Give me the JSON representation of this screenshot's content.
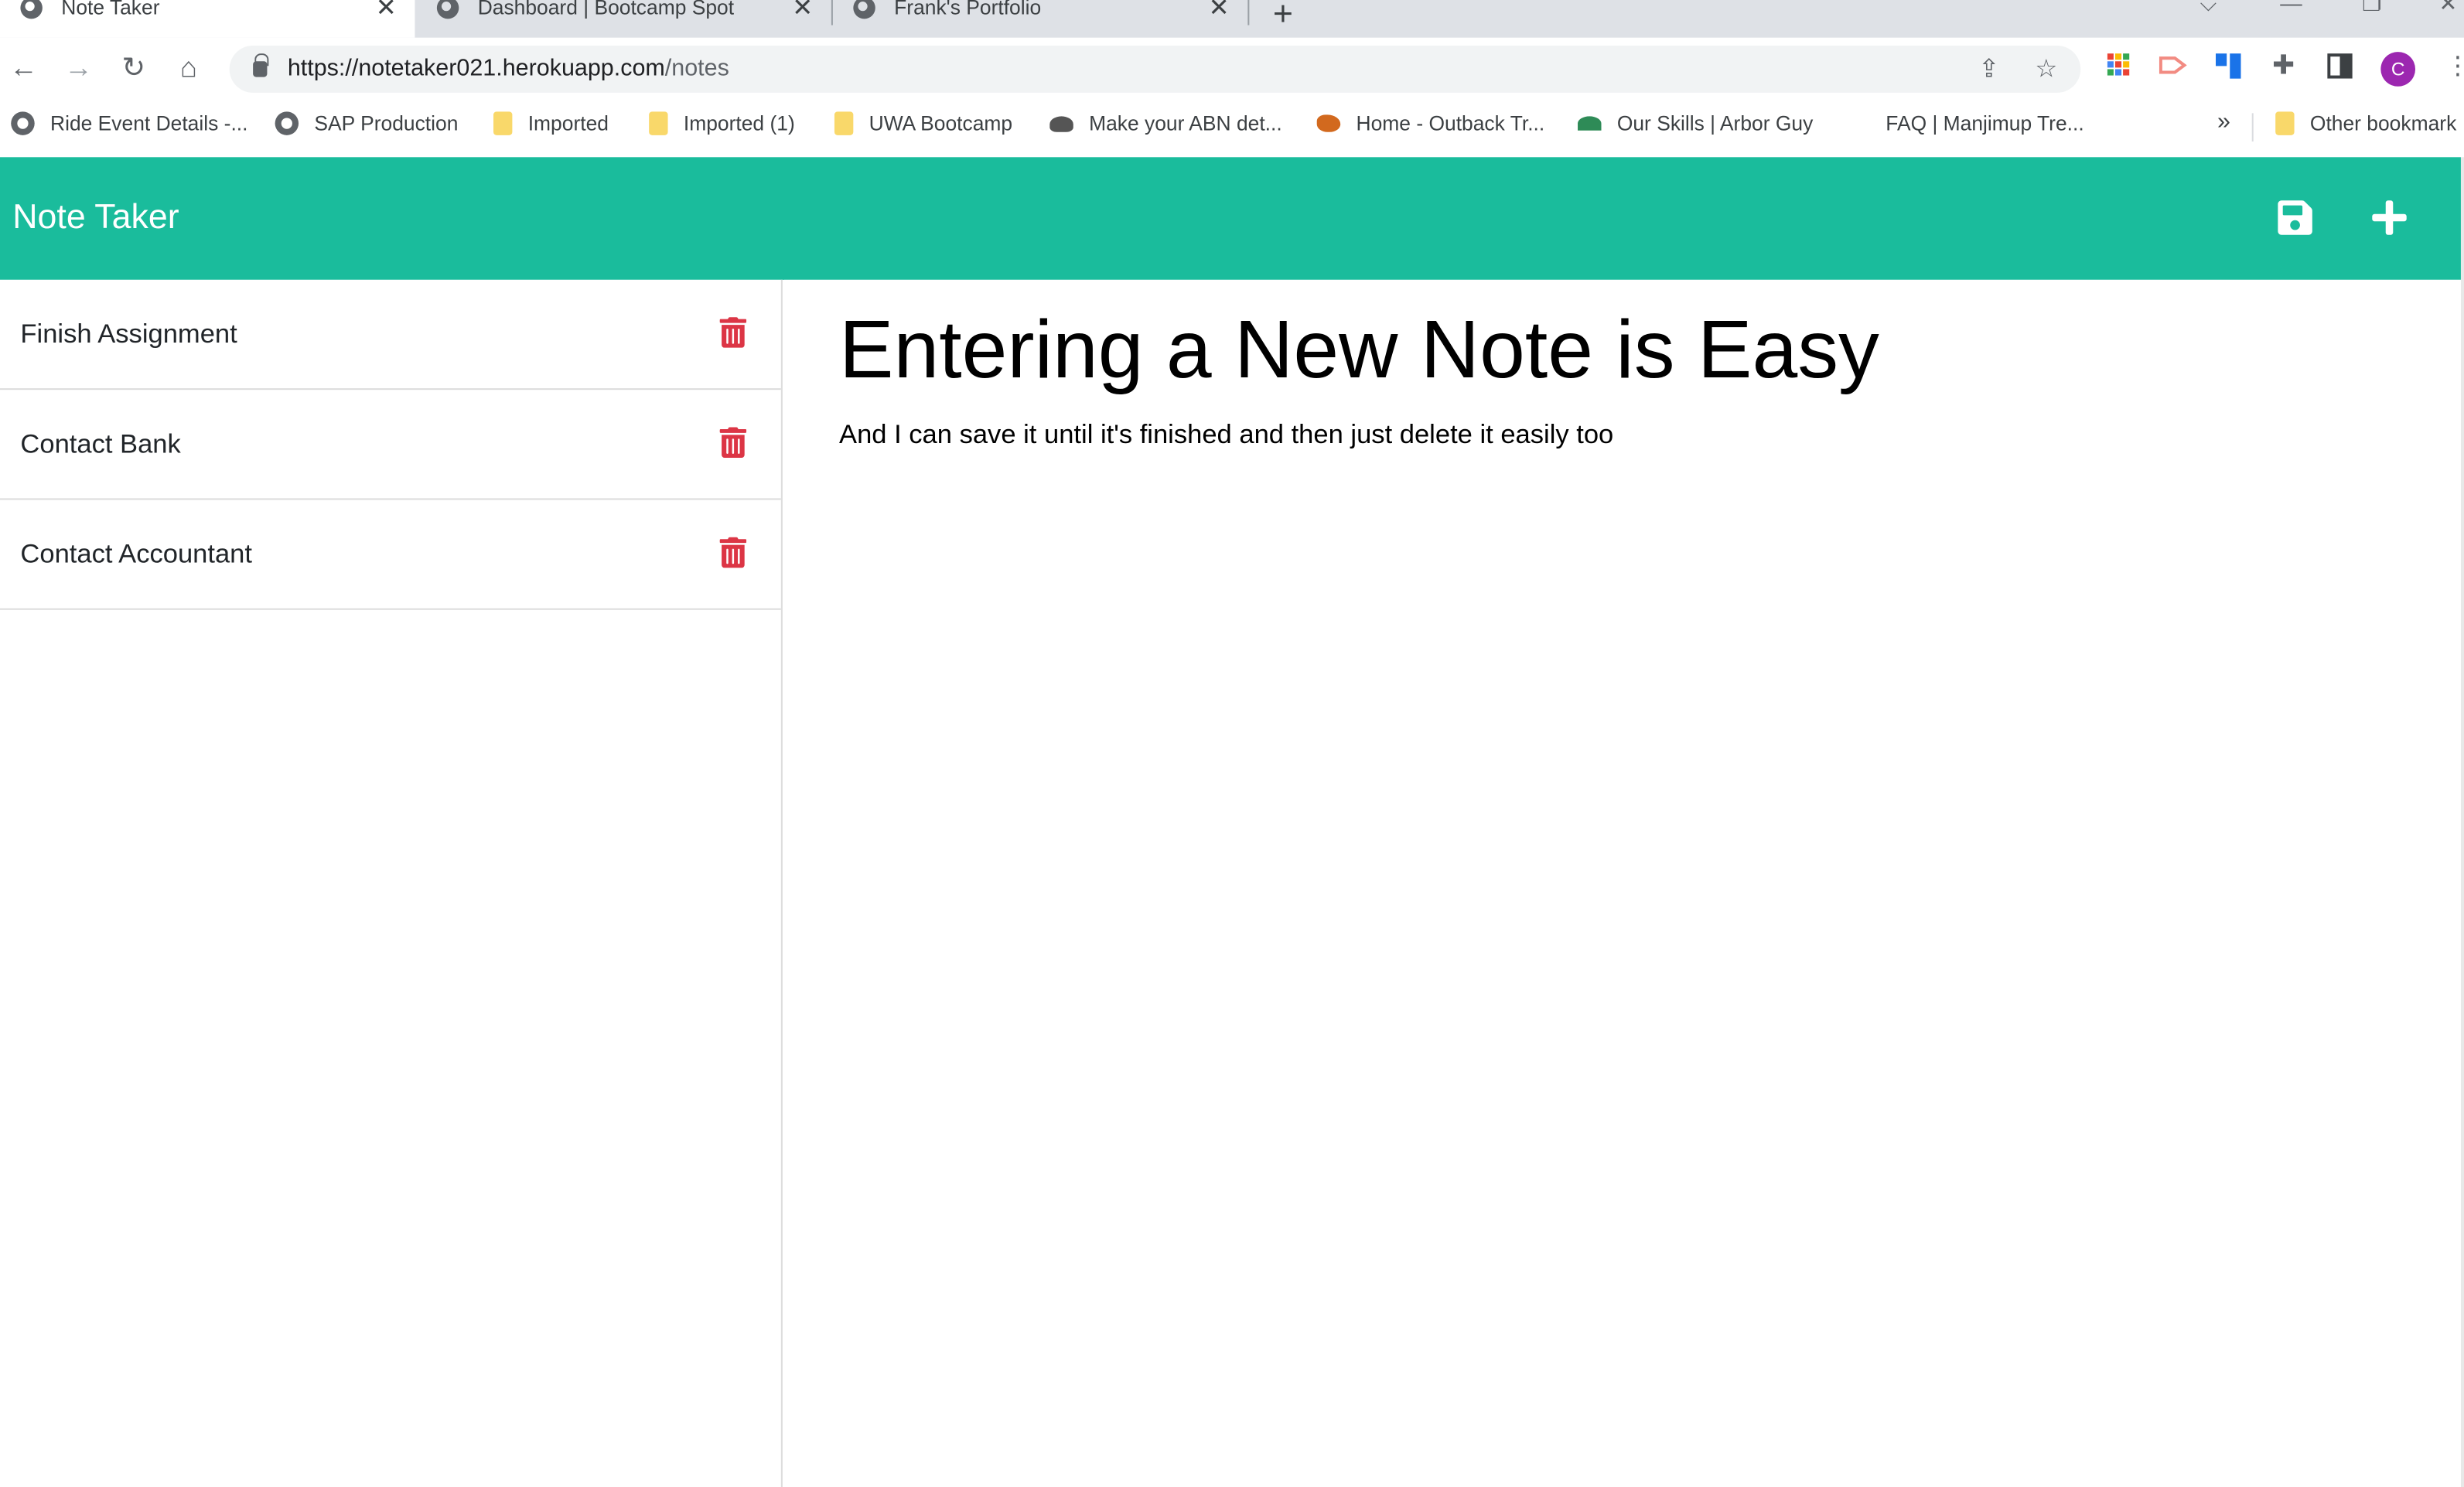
{
  "browser": {
    "tabs": [
      {
        "label": "Note Taker",
        "icon": "globe-icon",
        "active": true
      },
      {
        "label": "Dashboard | Bootcamp Spot",
        "icon": "globe-icon",
        "active": false
      },
      {
        "label": "Frank's Portfolio",
        "icon": "globe-icon",
        "active": false
      }
    ],
    "url_main": "https://notetaker021.herokuapp.com",
    "url_path": "/notes",
    "profile_initial": "C",
    "bookmarks": [
      {
        "label": "Ride Event Details -...",
        "icon": "globe-icon"
      },
      {
        "label": "SAP Production",
        "icon": "globe-icon"
      },
      {
        "label": "Imported",
        "icon": "folder-icon"
      },
      {
        "label": "Imported (1)",
        "icon": "folder-icon"
      },
      {
        "label": "UWA Bootcamp",
        "icon": "folder-icon"
      },
      {
        "label": "Make your ABN det...",
        "icon": "government-crest-icon"
      },
      {
        "label": "Home - Outback Tr...",
        "icon": "australia-map-icon"
      },
      {
        "label": "Our Skills | Arbor Guy",
        "icon": "palm-tree-icon"
      },
      {
        "label": "FAQ | Manjimup Tre...",
        "icon": ""
      }
    ],
    "more_bookmarks": "»",
    "other_bookmarks": "Other bookmark"
  },
  "app": {
    "brand": "Note Taker",
    "accent_color": "#1abc9c",
    "delete_color": "#dc3545",
    "notes": [
      {
        "title": "Finish Assignment"
      },
      {
        "title": "Contact Bank"
      },
      {
        "title": "Contact Accountant"
      }
    ],
    "active_note": {
      "title": "Entering a New Note is Easy",
      "text": "And I can save it until it's finished and then just delete it easily too"
    }
  }
}
